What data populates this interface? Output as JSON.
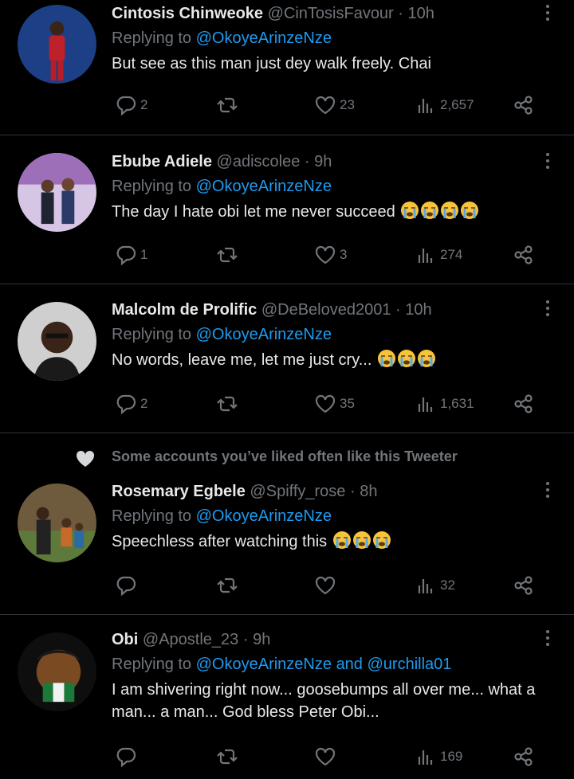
{
  "colors": {
    "background": "#000000",
    "text": "#e7e9ea",
    "muted": "#71767b",
    "link": "#1d9bf0",
    "divider": "#2f3336"
  },
  "tweets": [
    {
      "name": "Cintosis Chinweoke",
      "handle": "@CinTosisFavour",
      "time": "10h",
      "replying_prefix": "Replying to",
      "mentions": [
        "@OkoyeArinzeNze"
      ],
      "mention_joiner": "",
      "text": "But see as this man just dey walk freely. Chai",
      "emoji_count": 0,
      "replies": "2",
      "retweets": "",
      "likes": "23",
      "views": "2,657",
      "social_context": ""
    },
    {
      "name": "Ebube Adiele",
      "handle": "@adiscolee",
      "time": "9h",
      "replying_prefix": "Replying to",
      "mentions": [
        "@OkoyeArinzeNze"
      ],
      "mention_joiner": "",
      "text": "The day I hate obi let me never succeed",
      "emoji_count": 4,
      "replies": "1",
      "retweets": "",
      "likes": "3",
      "views": "274",
      "social_context": ""
    },
    {
      "name": "Malcolm de Prolific",
      "handle": "@DeBeloved2001",
      "time": "10h",
      "replying_prefix": "Replying to",
      "mentions": [
        "@OkoyeArinzeNze"
      ],
      "mention_joiner": "",
      "text": "No words, leave me, let me just cry...",
      "emoji_count": 3,
      "replies": "2",
      "retweets": "",
      "likes": "35",
      "views": "1,631",
      "social_context": ""
    },
    {
      "name": "Rosemary Egbele",
      "handle": "@Spiffy_rose",
      "time": "8h",
      "replying_prefix": "Replying to",
      "mentions": [
        "@OkoyeArinzeNze"
      ],
      "mention_joiner": "",
      "text": "Speechless after watching this",
      "emoji_count": 3,
      "replies": "",
      "retweets": "",
      "likes": "",
      "views": "32",
      "social_context": "Some accounts you’ve liked often like this Tweeter"
    },
    {
      "name": "Obi",
      "handle": "@Apostle_23",
      "time": "9h",
      "replying_prefix": "Replying to",
      "mentions": [
        "@OkoyeArinzeNze",
        "@urchilla01"
      ],
      "mention_joiner": "and",
      "text": "I am shivering right now... goosebumps all over me... what a man... a man... God bless Peter Obi...",
      "emoji_count": 0,
      "replies": "",
      "retweets": "",
      "likes": "",
      "views": "169",
      "social_context": ""
    }
  ],
  "icons": [
    "reply-icon",
    "retweet-icon",
    "like-icon",
    "views-icon",
    "share-icon",
    "more-icon",
    "crying-face-emoji",
    "heart-icon"
  ]
}
